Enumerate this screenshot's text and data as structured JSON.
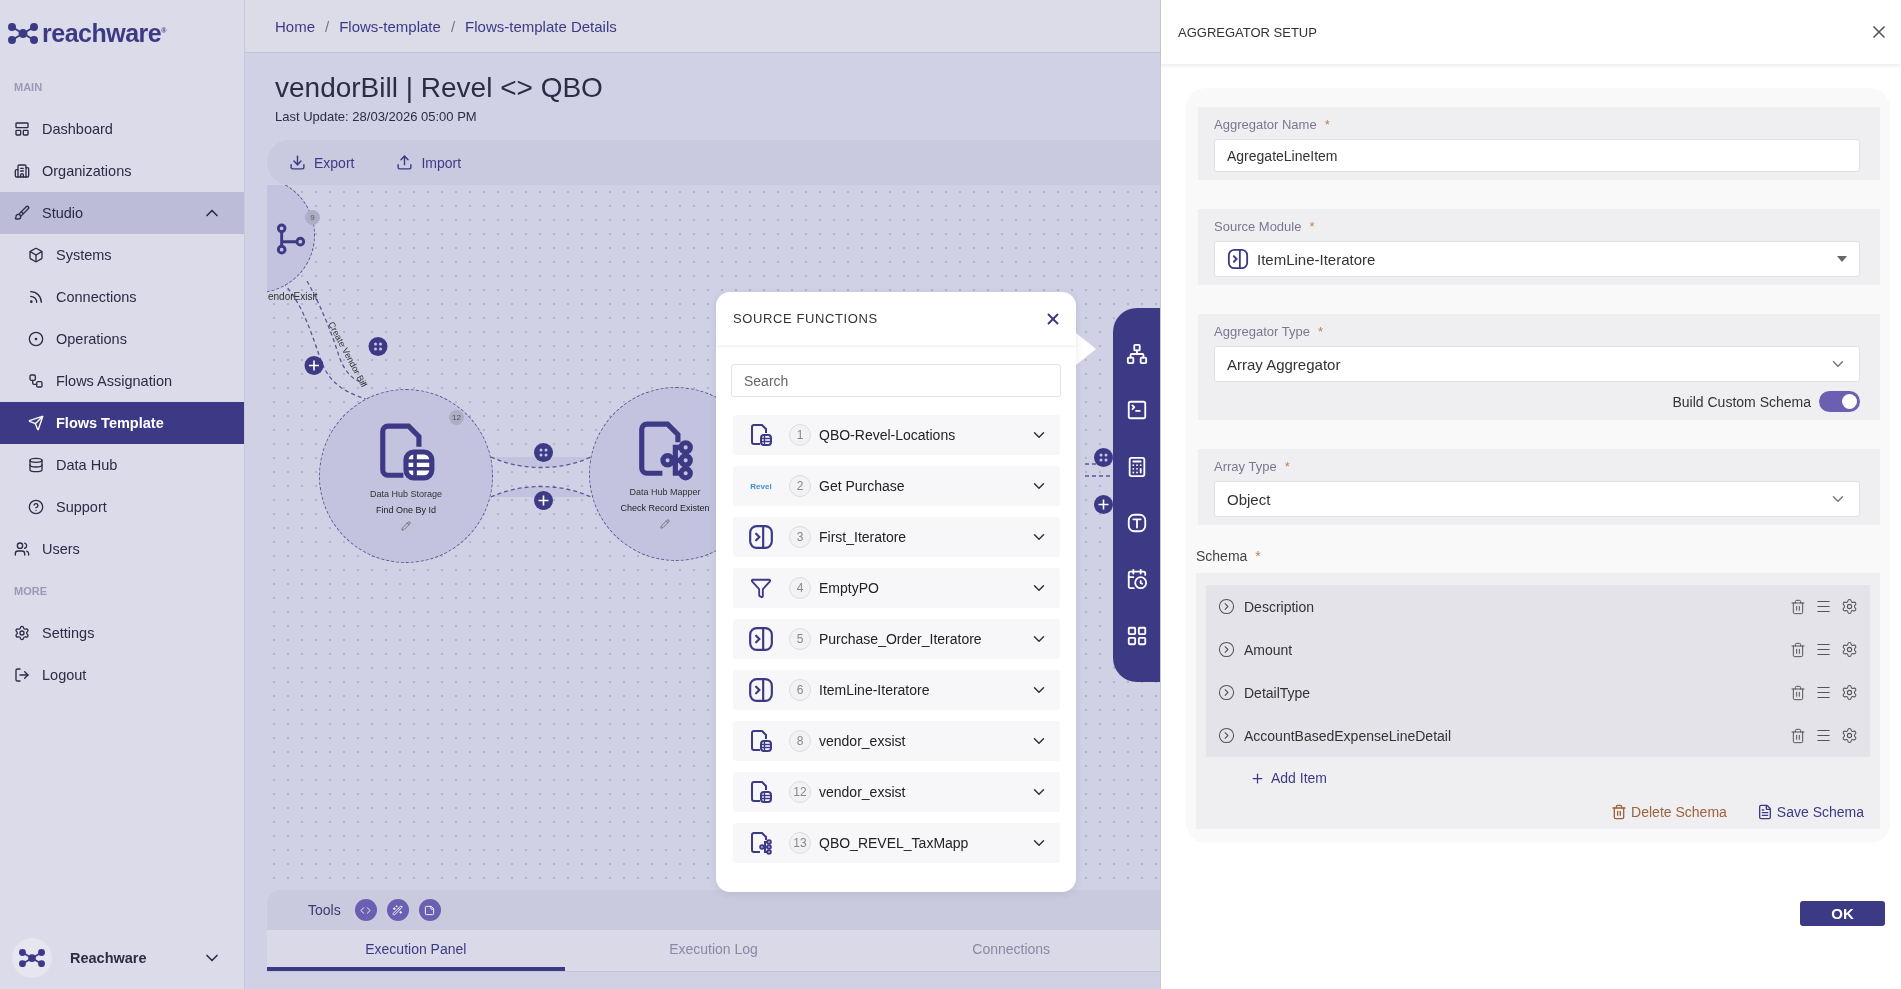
{
  "sidebar": {
    "logo": "reachware$^{®}$",
    "sections": [
      {
        "heading": "MAIN",
        "items": [
          {
            "label": "Dashboard",
            "selected": false
          },
          {
            "label": "Organizations",
            "selected": false
          },
          {
            "label": "Studio",
            "selected": false,
            "expanded": true,
            "children": [
              {
                "label": "Systems",
                "selected": false
              },
              {
                "label": "Connections",
                "selected": false
              },
              {
                "label": "Operations",
                "selected": false
              },
              {
                "label": "Flows Assignation",
                "selected": false
              },
              {
                "label": "Flows Template",
                "selected": true
              },
              {
                "label": "Data Hub",
                "selected": false
              },
              {
                "label": "Support",
                "selected": false
              }
            ]
          },
          {
            "label": "Users",
            "selected": false
          }
        ]
      },
      {
        "heading": "MORE",
        "items": [
          {
            "label": "Settings",
            "selected": false
          },
          {
            "label": "Logout",
            "selected": false
          }
        ]
      }
    ],
    "workspace": {
      "name": "Reachware"
    }
  },
  "breadcrumbs": {
    "separator": "/",
    "items": [
      "Home",
      "Flows-template",
      "Flows-template Details"
    ]
  },
  "page": {
    "title": "vendorBill | Revel <> QBO",
    "last_update": "Last Update: 28/03/2026 05:00 PM",
    "actions": [
      {
        "kind": "export",
        "label": "Export"
      },
      {
        "kind": "import",
        "label": "Import"
      }
    ]
  },
  "canvas": {
    "edge_label": "Create Vendor Bill",
    "nodes": [
      {
        "kind": "router",
        "badge": "9",
        "label": "endorExisit"
      },
      {
        "kind": "storage",
        "badge": "12",
        "title": "Data Hub Storage",
        "subtitle": "Find One By Id"
      },
      {
        "kind": "mapper",
        "title": "Data Hub Mapper",
        "subtitle": "Check Record Existen"
      }
    ]
  },
  "source_functions": {
    "title": "SOURCE FUNCTIONS",
    "search_placeholder": "Search",
    "items": [
      {
        "kind": "storage",
        "number": "1",
        "name": "QBO-Revel-Locations"
      },
      {
        "kind": "revel",
        "logo": "Revel",
        "number": "2",
        "name": "Get Purchase"
      },
      {
        "kind": "iterator",
        "number": "3",
        "name": "First_Iteratore"
      },
      {
        "kind": "filter",
        "number": "4",
        "name": "EmptyPO"
      },
      {
        "kind": "iterator",
        "number": "5",
        "name": "Purchase_Order_Iteratore"
      },
      {
        "kind": "iterator",
        "number": "6",
        "name": "ItemLine-Iteratore"
      },
      {
        "kind": "storage",
        "number": "8",
        "name": "vendor_exsist"
      },
      {
        "kind": "storage",
        "number": "12",
        "name": "vendor_exsist"
      },
      {
        "kind": "mapper",
        "number": "13",
        "name": "QBO_REVEL_TaxMapp"
      }
    ]
  },
  "tools": {
    "label": "Tools"
  },
  "bottom_tabs": [
    {
      "label": "Execution Panel",
      "selected": true
    },
    {
      "label": "Execution Log",
      "selected": false
    },
    {
      "label": "Connections",
      "selected": false
    }
  ],
  "panel": {
    "title": "AGGREGATOR SETUP",
    "fields": [
      {
        "kind": "text",
        "label": "Aggregator Name",
        "required": "*",
        "value": "AgregateLineItem"
      },
      {
        "kind": "module",
        "label": "Source Module",
        "required": "*",
        "value": "ItemLine-Iteratore"
      },
      {
        "kind": "select",
        "label": "Aggregator Type",
        "required": "*",
        "value": "Array Aggregator",
        "toggle": {
          "label": "Build Custom Schema",
          "on": true
        }
      },
      {
        "kind": "select",
        "label": "Array Type",
        "required": "*",
        "value": "Object"
      }
    ],
    "schema": {
      "label": "Schema",
      "required": "*",
      "items": [
        "Description",
        "Amount",
        "DetailType",
        "AccountBasedExpenseLineDetail"
      ],
      "add_label": "Add Item",
      "delete_label": "Delete Schema",
      "save_label": "Save Schema"
    },
    "ok_label": "OK"
  }
}
